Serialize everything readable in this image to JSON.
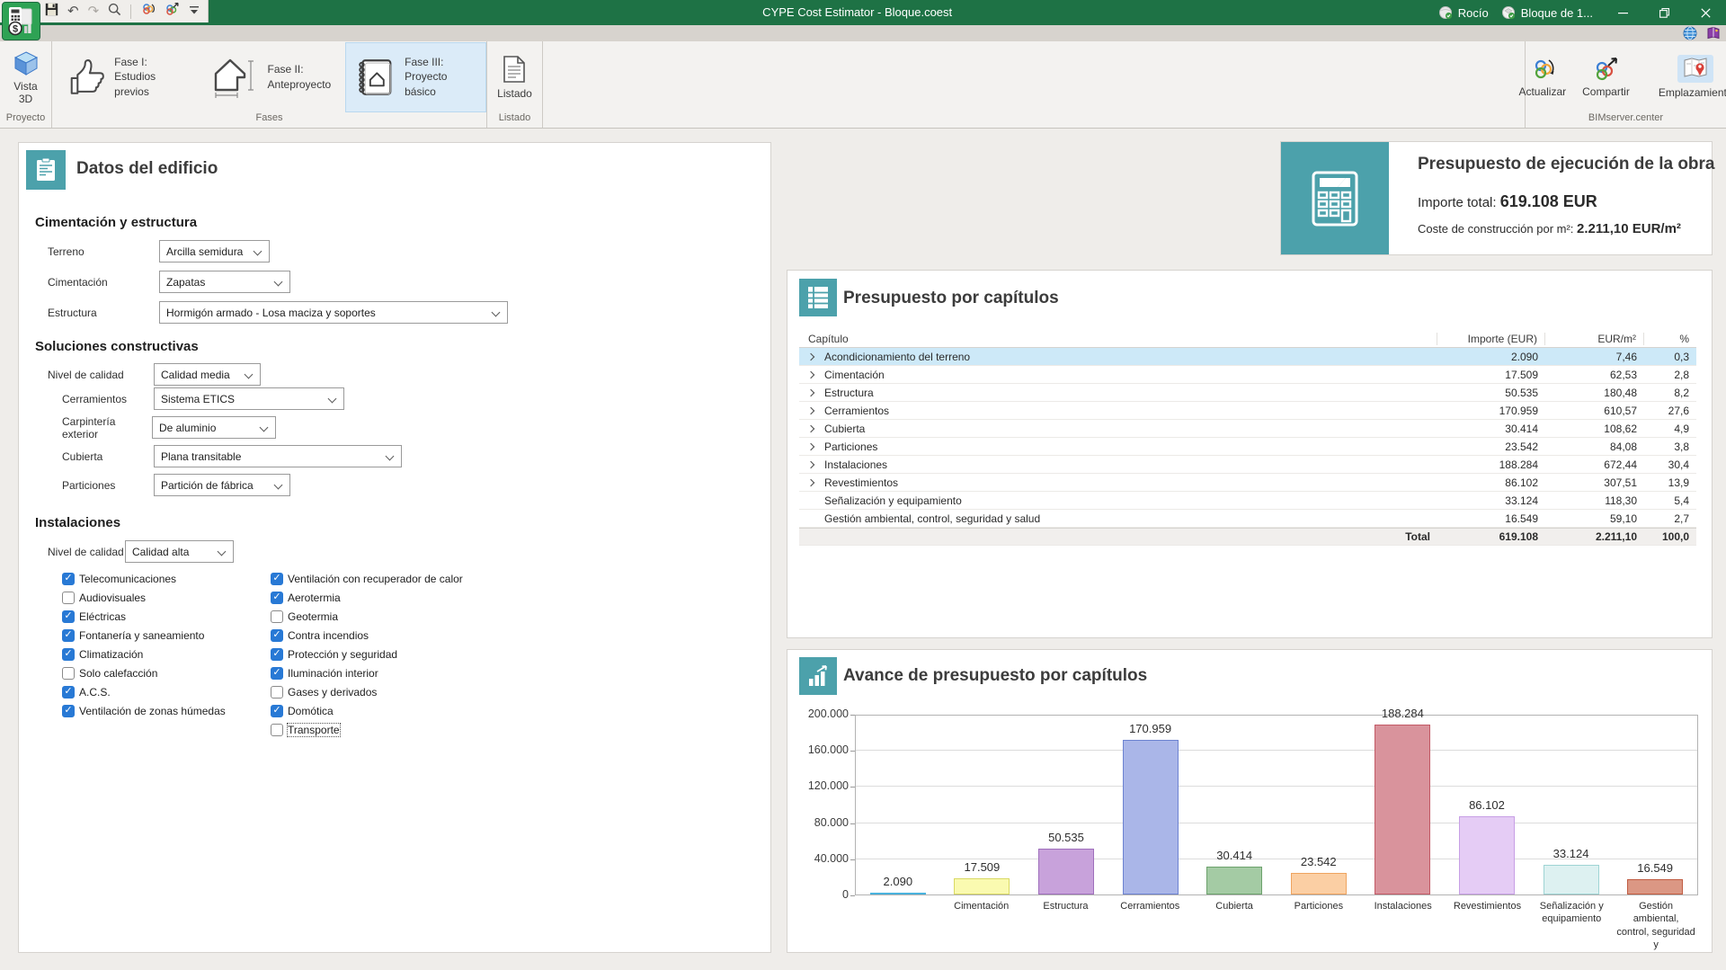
{
  "titlebar": {
    "title": "CYPE Cost Estimator - Bloque.coest",
    "user": "Rocío",
    "project": "Bloque de 1..."
  },
  "ribbon": {
    "groups": [
      {
        "label": "Proyecto"
      },
      {
        "label": "Fases"
      },
      {
        "label": "Listado"
      },
      {
        "label": "BIMserver.center"
      }
    ],
    "vista3d_line1": "Vista",
    "vista3d_line2": "3D",
    "fase1": {
      "line1": "Fase I:",
      "line2": "Estudios previos"
    },
    "fase2": {
      "line1": "Fase II:",
      "line2": "Anteproyecto"
    },
    "fase3": {
      "line1": "Fase III:",
      "line2": "Proyecto básico"
    },
    "listado": "Listado",
    "actualizar": "Actualizar",
    "compartir": "Compartir",
    "emplazamiento": "Emplazamiento"
  },
  "building": {
    "title": "Datos del edificio",
    "sections": {
      "foundation": {
        "heading": "Cimentación y estructura",
        "fields": [
          {
            "label": "Terreno",
            "value": "Arcilla semidura"
          },
          {
            "label": "Cimentación",
            "value": "Zapatas"
          },
          {
            "label": "Estructura",
            "value": "Hormigón armado - Losa maciza y soportes"
          }
        ]
      },
      "solutions": {
        "heading": "Soluciones constructivas",
        "fields": [
          {
            "label": "Nivel de calidad",
            "value": "Calidad media"
          },
          {
            "label": "Cerramientos",
            "value": "Sistema ETICS"
          },
          {
            "label": "Carpintería exterior",
            "value": "De aluminio"
          },
          {
            "label": "Cubierta",
            "value": "Plana transitable"
          },
          {
            "label": "Particiones",
            "value": "Partición de fábrica"
          }
        ]
      },
      "installations": {
        "heading": "Instalaciones",
        "quality": {
          "label": "Nivel de calidad",
          "value": "Calidad alta"
        },
        "col1": [
          {
            "label": "Telecomunicaciones",
            "checked": true
          },
          {
            "label": "Audiovisuales",
            "checked": false
          },
          {
            "label": "Eléctricas",
            "checked": true
          },
          {
            "label": "Fontanería y saneamiento",
            "checked": true
          },
          {
            "label": "Climatización",
            "checked": true
          },
          {
            "label": "Solo calefacción",
            "checked": false
          },
          {
            "label": "A.C.S.",
            "checked": true
          },
          {
            "label": "Ventilación de zonas húmedas",
            "checked": true
          }
        ],
        "col2": [
          {
            "label": "Ventilación con recuperador de calor",
            "checked": true
          },
          {
            "label": "Aerotermia",
            "checked": true
          },
          {
            "label": "Geotermia",
            "checked": false
          },
          {
            "label": "Contra incendios",
            "checked": true
          },
          {
            "label": "Protección y seguridad",
            "checked": true
          },
          {
            "label": "Iluminación interior",
            "checked": true
          },
          {
            "label": "Gases y derivados",
            "checked": false
          },
          {
            "label": "Domótica",
            "checked": true
          },
          {
            "label": "Transporte",
            "checked": false,
            "focused": true
          }
        ]
      }
    }
  },
  "summary": {
    "title": "Presupuesto de ejecución de la obra",
    "total_label": "Importe total:",
    "total_value": "619.108 EUR",
    "cost_label": "Coste de construcción por m²:",
    "cost_value": "2.211,10 EUR/m²"
  },
  "chapters": {
    "title": "Presupuesto por capítulos",
    "columns": [
      "Capítulo",
      "Importe (EUR)",
      "EUR/m²",
      "%"
    ],
    "rows": [
      {
        "name": "Acondicionamiento del terreno",
        "importe": "2.090",
        "eur_m2": "7,46",
        "pct": "0,3",
        "expandable": true,
        "selected": true
      },
      {
        "name": "Cimentación",
        "importe": "17.509",
        "eur_m2": "62,53",
        "pct": "2,8",
        "expandable": true,
        "selected": false
      },
      {
        "name": "Estructura",
        "importe": "50.535",
        "eur_m2": "180,48",
        "pct": "8,2",
        "expandable": true,
        "selected": false
      },
      {
        "name": "Cerramientos",
        "importe": "170.959",
        "eur_m2": "610,57",
        "pct": "27,6",
        "expandable": true,
        "selected": false
      },
      {
        "name": "Cubierta",
        "importe": "30.414",
        "eur_m2": "108,62",
        "pct": "4,9",
        "expandable": true,
        "selected": false
      },
      {
        "name": "Particiones",
        "importe": "23.542",
        "eur_m2": "84,08",
        "pct": "3,8",
        "expandable": true,
        "selected": false
      },
      {
        "name": "Instalaciones",
        "importe": "188.284",
        "eur_m2": "672,44",
        "pct": "30,4",
        "expandable": true,
        "selected": false
      },
      {
        "name": "Revestimientos",
        "importe": "86.102",
        "eur_m2": "307,51",
        "pct": "13,9",
        "expandable": true,
        "selected": false
      },
      {
        "name": "Señalización y equipamiento",
        "importe": "33.124",
        "eur_m2": "118,30",
        "pct": "5,4",
        "expandable": false,
        "selected": false
      },
      {
        "name": "Gestión ambiental, control, seguridad y salud",
        "importe": "16.549",
        "eur_m2": "59,10",
        "pct": "2,7",
        "expandable": false,
        "selected": false
      }
    ],
    "total": {
      "label": "Total",
      "importe": "619.108",
      "eur_m2": "2.211,10",
      "pct": "100,0"
    }
  },
  "chart_data": {
    "type": "bar",
    "title": "Avance de presupuesto por capítulos",
    "categories": [
      "",
      "Cimentación",
      "Estructura",
      "Cerramientos",
      "Cubierta",
      "Particiones",
      "Instalaciones",
      "Revestimientos",
      "Señalización y equipamiento",
      "Gestión ambiental, control, seguridad y"
    ],
    "values": [
      2090,
      17509,
      50535,
      170959,
      30414,
      23542,
      188284,
      86102,
      33124,
      16549
    ],
    "value_labels": [
      "2.090",
      "17.509",
      "50.535",
      "170.959",
      "30.414",
      "23.542",
      "188.284",
      "86.102",
      "33.124",
      "16.549"
    ],
    "ylim": [
      0,
      200000
    ],
    "ytick_step": 40000,
    "ytick_labels": [
      "0",
      "40.000",
      "80.000",
      "120.000",
      "160.000",
      "200.000"
    ],
    "bar_colors": [
      "#8ED3EE",
      "#FAFAB0",
      "#C8A2DB",
      "#AAB6E8",
      "#A4CBA4",
      "#FBCFA4",
      "#D9939C",
      "#E5CCF5",
      "#DDF1F1",
      "#DB9784"
    ],
    "bar_border_colors": [
      "#49B2DD",
      "#D9D964",
      "#9F6FBC",
      "#6D83D1",
      "#6DA26D",
      "#EFA460",
      "#C25A66",
      "#C79FE5",
      "#9ED4D4",
      "#C05C42"
    ],
    "grid": true,
    "legend": false
  },
  "colors": {
    "titlebar_green": "#1E7245",
    "accent_teal": "#4CA1AB",
    "checkbox_blue": "#2879D5",
    "selected_row_blue": "#CDE9F8"
  }
}
